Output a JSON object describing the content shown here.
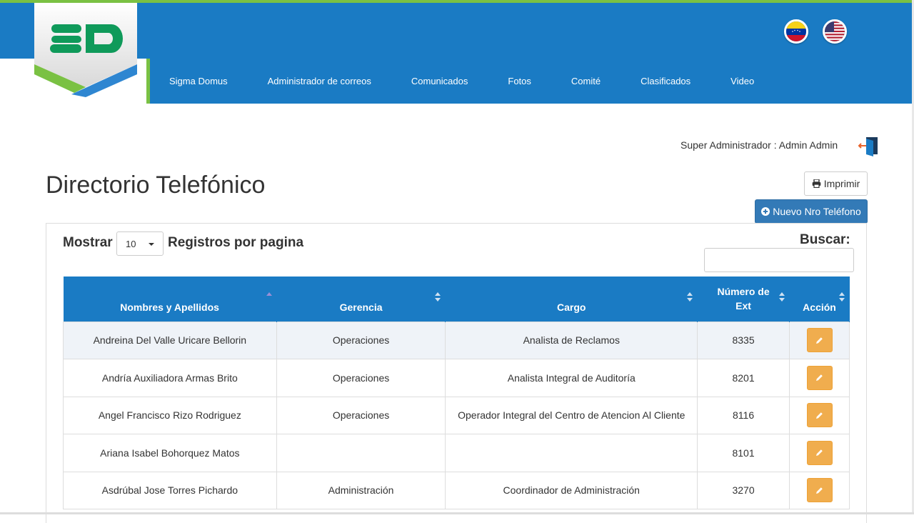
{
  "brand": {
    "logo_text": "SD",
    "accent": "#1a7bc4",
    "green": "#7ac143"
  },
  "nav": {
    "items": [
      {
        "label": "Sigma Domus"
      },
      {
        "label": "Administrador de correos"
      },
      {
        "label": "Comunicados"
      },
      {
        "label": "Fotos"
      },
      {
        "label": "Comité"
      },
      {
        "label": "Clasificados"
      },
      {
        "label": "Video"
      }
    ]
  },
  "languages": [
    {
      "name": "venezuela-flag-icon"
    },
    {
      "name": "usa-flag-icon"
    }
  ],
  "user": {
    "label": "Super Administrador : Admin Admin"
  },
  "page": {
    "title": "Directorio Telefónico"
  },
  "actions": {
    "print_label": "Imprimir",
    "new_label": "Nuevo Nro Teléfono"
  },
  "table_controls": {
    "show_label": "Mostrar",
    "page_size": "10",
    "per_page_label": "Registros por pagina",
    "search_label": "Buscar:",
    "search_value": ""
  },
  "table": {
    "columns": [
      {
        "label": "Nombres y Apellidos"
      },
      {
        "label": "Gerencia"
      },
      {
        "label": "Cargo"
      },
      {
        "label": "Número de Ext"
      },
      {
        "label": "Acción"
      }
    ],
    "rows": [
      {
        "name": "Andreina Del Valle Uricare Bellorin",
        "gerencia": "Operaciones",
        "cargo": "Analista de Reclamos",
        "ext": "8335"
      },
      {
        "name": "Andría Auxiliadora Armas Brito",
        "gerencia": "Operaciones",
        "cargo": "Analista Integral de Auditoría",
        "ext": "8201"
      },
      {
        "name": "Angel Francisco Rizo Rodriguez",
        "gerencia": "Operaciones",
        "cargo": "Operador Integral del Centro de Atencion Al Cliente",
        "ext": "8116"
      },
      {
        "name": "Ariana Isabel Bohorquez Matos",
        "gerencia": "",
        "cargo": "",
        "ext": "8101"
      },
      {
        "name": "Asdrúbal Jose Torres Pichardo",
        "gerencia": "Administración",
        "cargo": "Coordinador de Administración",
        "ext": "3270"
      }
    ]
  }
}
